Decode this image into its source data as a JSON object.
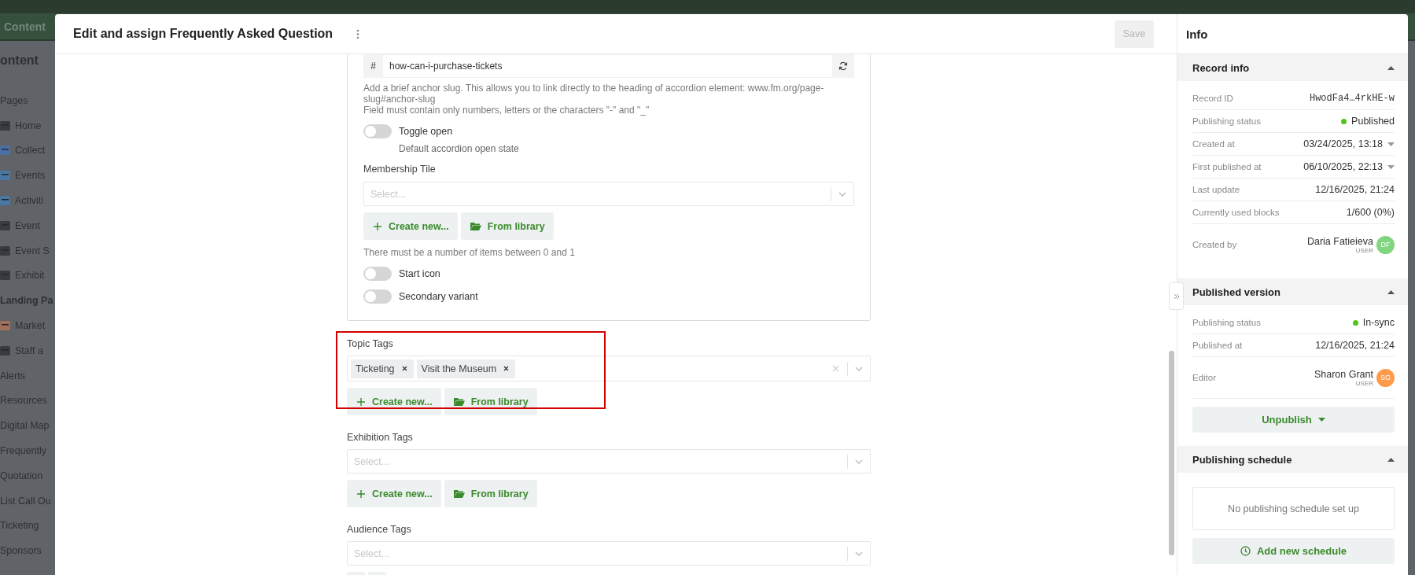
{
  "app_bar": {
    "tab": "Content"
  },
  "sidebar": {
    "title": "ontent",
    "items": [
      {
        "label": "Pages",
        "kind": "plain"
      },
      {
        "label": "Home",
        "kind": "icon_item"
      },
      {
        "label": "Collect",
        "kind": "icon_item"
      },
      {
        "label": "Events",
        "kind": "icon_item"
      },
      {
        "label": "Activiti",
        "kind": "icon_item"
      },
      {
        "label": "Event",
        "kind": "icon_item"
      },
      {
        "label": "Event S",
        "kind": "icon_item"
      },
      {
        "label": "Exhibit",
        "kind": "icon_item"
      },
      {
        "label": "Landing Pa",
        "kind": "bold"
      },
      {
        "label": "Market",
        "kind": "icon_item"
      },
      {
        "label": "Staff a",
        "kind": "icon_item"
      },
      {
        "label": "Alerts",
        "kind": "plain"
      },
      {
        "label": "Resources",
        "kind": "plain"
      },
      {
        "label": "Digital Map",
        "kind": "plain"
      },
      {
        "label": "Frequently",
        "kind": "plain"
      },
      {
        "label": "Quotation",
        "kind": "plain"
      },
      {
        "label": "List Call Ou",
        "kind": "plain"
      },
      {
        "label": "Ticketing",
        "kind": "plain"
      },
      {
        "label": "Sponsors",
        "kind": "plain"
      }
    ]
  },
  "dialog": {
    "title": "Edit and assign Frequently Asked Question",
    "save_button": {
      "label": "Save",
      "disabled": true
    }
  },
  "card_items": [
    {
      "kind": "slug",
      "prefix": "#",
      "value": "how-can-i-purchase-tickets",
      "help": [
        "Add a brief anchor slug. This allows you to link directly to the heading of accordion element: www.fm.org/page-slug#anchor-slug",
        "Field must contain only numbers, letters or the characters \"-\" and \"_\""
      ]
    },
    {
      "kind": "toggle",
      "label": "Toggle open",
      "on": false,
      "description": "Default accordion open state"
    },
    {
      "kind": "reference",
      "label": "Membership Tile",
      "placeholder": "Select...",
      "actions": [
        {
          "kind": "create",
          "label": "Create new..."
        },
        {
          "kind": "library",
          "label": "From library"
        }
      ],
      "hint": "There must be a number of items between 0 and 1"
    },
    {
      "kind": "toggle",
      "label": "Start icon",
      "on": false
    },
    {
      "kind": "toggle",
      "label": "Secondary variant",
      "on": false
    }
  ],
  "tag_fields": [
    {
      "label": "Topic Tags",
      "highlighted": true,
      "tags": [
        "Ticketing",
        "Visit the Museum"
      ],
      "actions": [
        {
          "kind": "create",
          "label": "Create new..."
        },
        {
          "kind": "library",
          "label": "From library"
        }
      ]
    },
    {
      "label": "Exhibition Tags",
      "highlighted": false,
      "placeholder": "Select...",
      "actions": [
        {
          "kind": "create",
          "label": "Create new..."
        },
        {
          "kind": "library",
          "label": "From library"
        }
      ]
    },
    {
      "label": "Audience Tags",
      "highlighted": false,
      "placeholder": "Select...",
      "actions": [
        {
          "kind": "create"
        },
        {
          "kind": "library"
        }
      ]
    }
  ],
  "info": {
    "title": "Info",
    "sections": [
      {
        "title": "Record info",
        "expanded": true,
        "rows": [
          {
            "label": "Record ID",
            "kind": "mono",
            "value": "HwodFa4…4rkHE-w"
          },
          {
            "label": "Publishing status",
            "kind": "status",
            "value": "Published",
            "color": "#52c41a"
          },
          {
            "label": "Created at",
            "kind": "dropdown",
            "value": "03/24/2025, 13:18"
          },
          {
            "label": "First published at",
            "kind": "dropdown",
            "value": "06/10/2025, 22:13"
          },
          {
            "label": "Last update",
            "kind": "plain",
            "value": "12/16/2025, 21:24"
          },
          {
            "label": "Currently used blocks",
            "kind": "plain",
            "value": "1/600 (0%)"
          },
          {
            "label": "Created by",
            "kind": "user",
            "value": "Daria Fatieieva",
            "role": "USER",
            "initials": "DF",
            "color": "#7fd67f"
          }
        ]
      },
      {
        "title": "Published version",
        "expanded": true,
        "rows": [
          {
            "label": "Publishing status",
            "kind": "status",
            "value": "In-sync",
            "color": "#52c41a"
          },
          {
            "label": "Published at",
            "kind": "plain",
            "value": "12/16/2025, 21:24"
          },
          {
            "label": "Editor",
            "kind": "user",
            "value": "Sharon Grant",
            "role": "USER",
            "initials": "SG",
            "color": "#ff9a4a"
          }
        ],
        "button": {
          "kind": "menu",
          "label": "Unpublish"
        }
      },
      {
        "title": "Publishing schedule",
        "expanded": true,
        "empty_text": "No publishing schedule set up",
        "button": {
          "kind": "schedule",
          "label": "Add new schedule"
        }
      }
    ]
  }
}
